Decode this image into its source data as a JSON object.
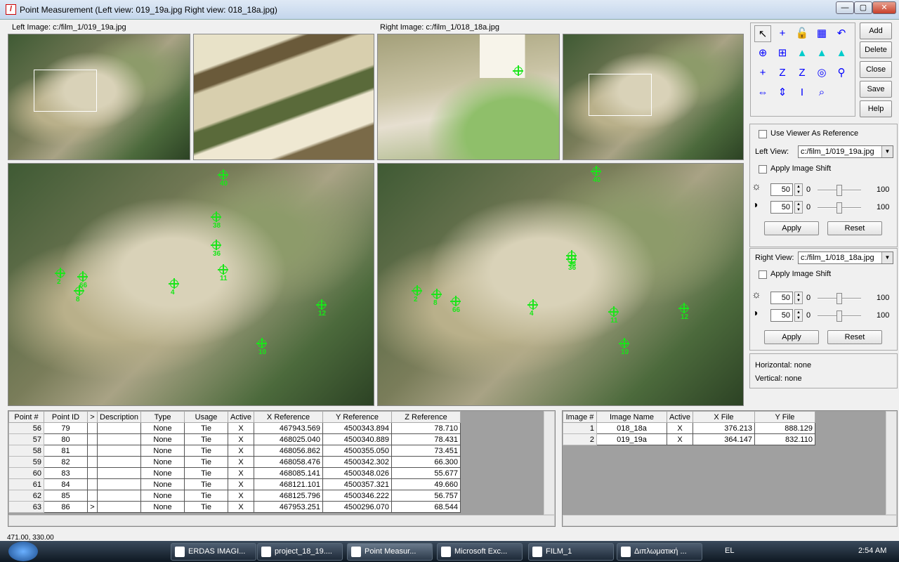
{
  "window": {
    "title": "Point Measurement (Left view: 019_19a.jpg  Right view: 018_18a.jpg)",
    "minimize": "—",
    "maximize": "▢",
    "close": "✕"
  },
  "views": {
    "left_label": "Left Image: c:/film_1/019_19a.jpg",
    "right_label": "Right Image: c:/film_1/018_18a.jpg",
    "left_markers": [
      "40",
      "38",
      "2",
      "66",
      "8",
      "4",
      "10",
      "12",
      "11",
      "36"
    ],
    "right_markers": [
      "40",
      "38",
      "2",
      "66",
      "8",
      "4",
      "10",
      "12",
      "11",
      "36"
    ]
  },
  "toolbar": {
    "tools": [
      "select-arrow",
      "crosshair",
      "lock",
      "viewer-layout",
      "undo",
      "create-point",
      "create-table",
      "triangle",
      "triangle-view",
      "triangle-file",
      "add-point",
      "z-value",
      "z-box",
      "link-viewers",
      "chain-link",
      "drive-left",
      "drive-updown",
      "i-arrow",
      "zoom-view"
    ]
  },
  "buttons": {
    "add": "Add",
    "delete": "Delete",
    "close": "Close",
    "save": "Save",
    "help": "Help"
  },
  "reference": {
    "use_viewer": "Use Viewer As Reference"
  },
  "left_view": {
    "label": "Left View:",
    "file": "c:/film_1/019_19a.jpg",
    "apply_shift": "Apply Image Shift",
    "brightness": "50",
    "contrast": "50",
    "min": "0",
    "max": "100",
    "apply": "Apply",
    "reset": "Reset"
  },
  "right_view": {
    "label": "Right View:",
    "file": "c:/film_1/018_18a.jpg",
    "apply_shift": "Apply Image Shift",
    "brightness": "50",
    "contrast": "50",
    "min": "0",
    "max": "100",
    "apply": "Apply",
    "reset": "Reset"
  },
  "info": {
    "horizontal": "Horizontal: none",
    "vertical": "Vertical: none"
  },
  "point_table": {
    "headers": [
      "Point #",
      "Point ID",
      ">",
      "Description",
      "Type",
      "Usage",
      "Active",
      "X Reference",
      "Y Reference",
      "Z Reference"
    ],
    "rows": [
      [
        "56",
        "79",
        "",
        "",
        "None",
        "Tie",
        "X",
        "467943.569",
        "4500343.894",
        "78.710"
      ],
      [
        "57",
        "80",
        "",
        "",
        "None",
        "Tie",
        "X",
        "468025.040",
        "4500340.889",
        "78.431"
      ],
      [
        "58",
        "81",
        "",
        "",
        "None",
        "Tie",
        "X",
        "468056.862",
        "4500355.050",
        "73.451"
      ],
      [
        "59",
        "82",
        "",
        "",
        "None",
        "Tie",
        "X",
        "468058.476",
        "4500342.302",
        "66.300"
      ],
      [
        "60",
        "83",
        "",
        "",
        "None",
        "Tie",
        "X",
        "468085.141",
        "4500348.026",
        "55.677"
      ],
      [
        "61",
        "84",
        "",
        "",
        "None",
        "Tie",
        "X",
        "468121.101",
        "4500357.321",
        "49.660"
      ],
      [
        "62",
        "85",
        "",
        "",
        "None",
        "Tie",
        "X",
        "468125.796",
        "4500346.222",
        "56.757"
      ],
      [
        "63",
        "86",
        ">",
        "",
        "None",
        "Tie",
        "X",
        "467953.251",
        "4500296.070",
        "68.544"
      ]
    ]
  },
  "image_table": {
    "headers": [
      "Image #",
      "Image Name",
      "Active",
      "X File",
      "Y File"
    ],
    "rows": [
      [
        "1",
        "018_18a",
        "X",
        "376.213",
        "888.129"
      ],
      [
        "2",
        "019_19a",
        "X",
        "364.147",
        "832.110"
      ]
    ]
  },
  "status": {
    "coords": "471.00, 330.00"
  },
  "taskbar": {
    "items": [
      "ERDAS IMAGI...",
      "project_18_19....",
      "Point Measur...",
      "Microsoft Exc...",
      "FILM_1",
      "Διπλωματική ..."
    ],
    "language": "EL",
    "time": "2:54 AM"
  }
}
